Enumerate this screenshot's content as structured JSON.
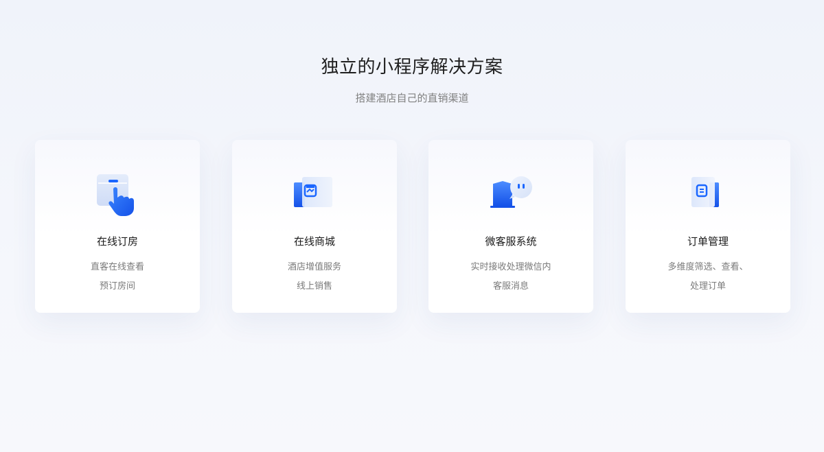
{
  "section": {
    "title": "独立的小程序解决方案",
    "subtitle": "搭建酒店自己的直销渠道"
  },
  "cards": [
    {
      "icon": "hand-tap-icon",
      "title": "在线订房",
      "desc_line1": "直客在线查看",
      "desc_line2": "预订房间"
    },
    {
      "icon": "storefront-icon",
      "title": "在线商城",
      "desc_line1": "酒店增值服务",
      "desc_line2": "线上销售"
    },
    {
      "icon": "chat-bubble-icon",
      "title": "微客服系统",
      "desc_line1": "实时接收处理微信内",
      "desc_line2": "客服消息"
    },
    {
      "icon": "order-document-icon",
      "title": "订单管理",
      "desc_line1": "多维度筛选、查看、",
      "desc_line2": "处理订单"
    }
  ],
  "colors": {
    "accent": "#1a66ff",
    "accent_light": "#4d8dff",
    "title": "#1f1f1f",
    "muted": "#808080"
  }
}
